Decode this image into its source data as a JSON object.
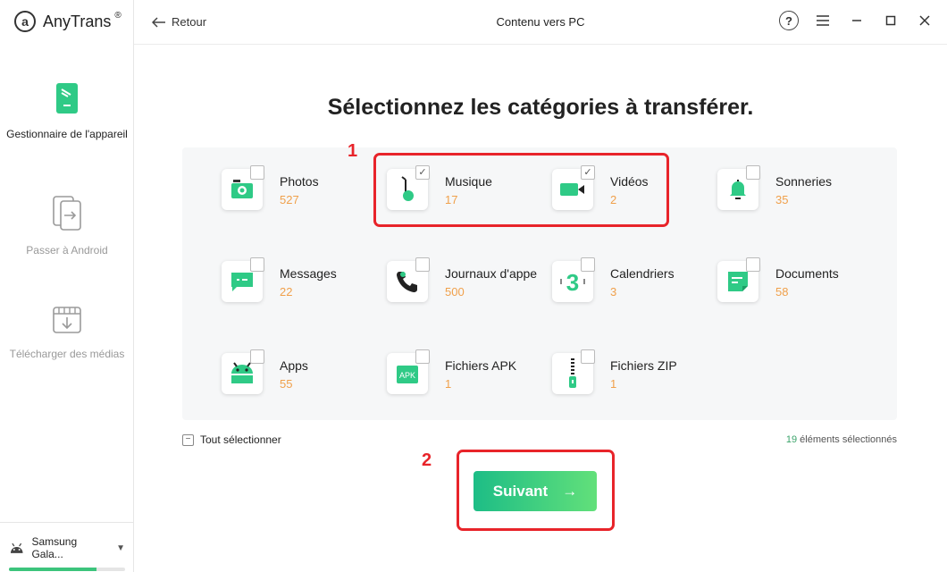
{
  "app": {
    "name": "AnyTrans",
    "registered": "®"
  },
  "sidebar": {
    "items": [
      {
        "label": "Gestionnaire de l'appareil",
        "active": true
      },
      {
        "label": "Passer à Android",
        "active": false
      },
      {
        "label": "Télécharger des médias",
        "active": false
      }
    ],
    "device": {
      "name": "Samsung Gala...",
      "storage_used_fraction": 0.75
    }
  },
  "header": {
    "back_label": "Retour",
    "title": "Contenu vers PC",
    "help_label": "?"
  },
  "main": {
    "headline": "Sélectionnez les catégories à transférer.",
    "categories": [
      {
        "name": "Photos",
        "count": "527",
        "checked": false,
        "icon": "photos-icon"
      },
      {
        "name": "Musique",
        "count": "17",
        "checked": true,
        "icon": "music-icon"
      },
      {
        "name": "Vidéos",
        "count": "2",
        "checked": true,
        "icon": "video-icon"
      },
      {
        "name": "Sonneries",
        "count": "35",
        "checked": false,
        "icon": "bell-icon"
      },
      {
        "name": "Messages",
        "count": "22",
        "checked": false,
        "icon": "message-icon"
      },
      {
        "name": "Journaux d'appels",
        "count": "500",
        "checked": false,
        "icon": "phone-icon"
      },
      {
        "name": "Calendriers",
        "count": "3",
        "checked": false,
        "icon": "calendar-icon"
      },
      {
        "name": "Documents",
        "count": "58",
        "checked": false,
        "icon": "document-icon"
      },
      {
        "name": "Apps",
        "count": "55",
        "checked": false,
        "icon": "android-icon"
      },
      {
        "name": "Fichiers APK",
        "count": "1",
        "checked": false,
        "icon": "apk-icon"
      },
      {
        "name": "Fichiers ZIP",
        "count": "1",
        "checked": false,
        "icon": "zip-icon"
      }
    ],
    "check_mark": "✓",
    "select_all_label": "Tout sélectionner",
    "select_all_mark": "−",
    "selected_count": "19",
    "selected_suffix": "éléments sélectionnés",
    "next_label": "Suivant",
    "next_arrow": "→"
  },
  "annotations": {
    "label_1": "1",
    "label_2": "2"
  },
  "colors": {
    "accent": "#3cc47c",
    "count": "#f0a04b",
    "highlight": "#e8242a"
  }
}
